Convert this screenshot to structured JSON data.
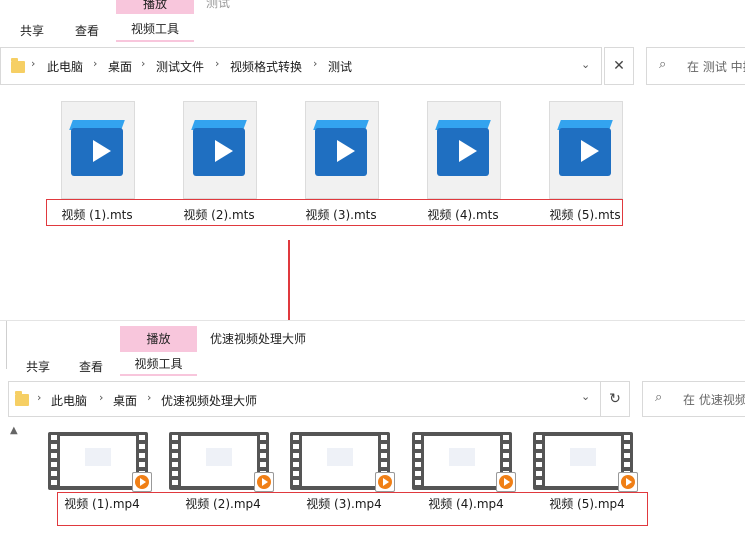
{
  "top_window": {
    "title_partial": "测试",
    "tabs": {
      "share": "共享",
      "view": "查看",
      "play": "播放",
      "video_tools": "视频工具"
    },
    "breadcrumbs": [
      "此电脑",
      "桌面",
      "测试文件",
      "视频格式转换",
      "测试"
    ],
    "search_placeholder": "在 测试 中搜",
    "files": [
      "视频 (1).mts",
      "视频 (2).mts",
      "视频 (3).mts",
      "视频 (4).mts",
      "视频 (5).mts"
    ]
  },
  "bottom_window": {
    "title": "优速视频处理大师",
    "tabs": {
      "share": "共享",
      "view": "查看",
      "play": "播放",
      "video_tools": "视频工具"
    },
    "breadcrumbs": [
      "此电脑",
      "桌面",
      "优速视频处理大师"
    ],
    "search_placeholder": "在 优速视频",
    "files": [
      "视频 (1).mp4",
      "视频 (2).mp4",
      "视频 (3).mp4",
      "视频 (4).mp4",
      "视频 (5).mp4"
    ]
  },
  "colors": {
    "highlight_box": "#e0393e",
    "arrow": "#e0393e",
    "context_tab": "#f8c6dc",
    "folder": "#f6cf64"
  }
}
